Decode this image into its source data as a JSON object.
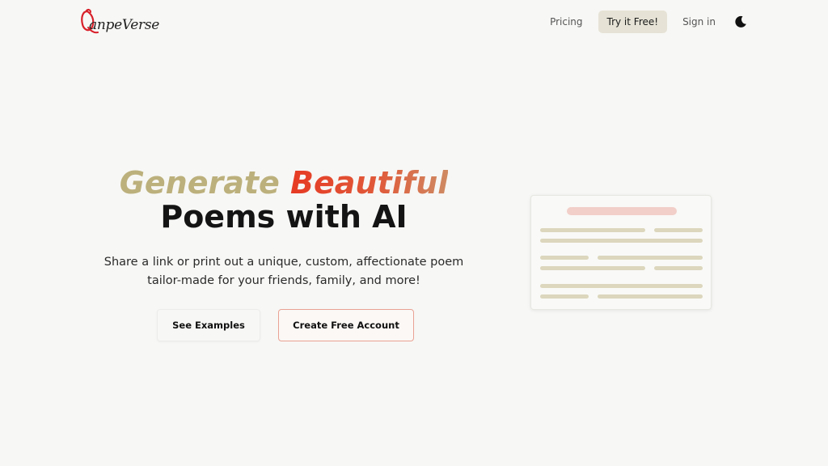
{
  "header": {
    "brand": "anpeVerse",
    "nav": {
      "pricing": "Pricing",
      "try_free": "Try it Free!",
      "sign_in": "Sign in"
    },
    "theme_toggle_icon": "moon-icon"
  },
  "hero": {
    "headline_word1": "Generate",
    "headline_word2": "Beautiful",
    "headline_line2": "Poems with AI",
    "subtitle_line1": "Share a link or print out a unique, custom, affectionate poem",
    "subtitle_line2": "tailor-made for your friends, family, and more!",
    "see_examples": "See Examples",
    "create_account": "Create Free Account"
  },
  "colors": {
    "background": "#f7f7f5",
    "accent_gold": "#bcb07c",
    "accent_red": "#e63a23",
    "button_border": "#e9a294",
    "try_button_bg": "#e6e3d6"
  },
  "illustration": {
    "icon": "poem-document-illustration"
  }
}
